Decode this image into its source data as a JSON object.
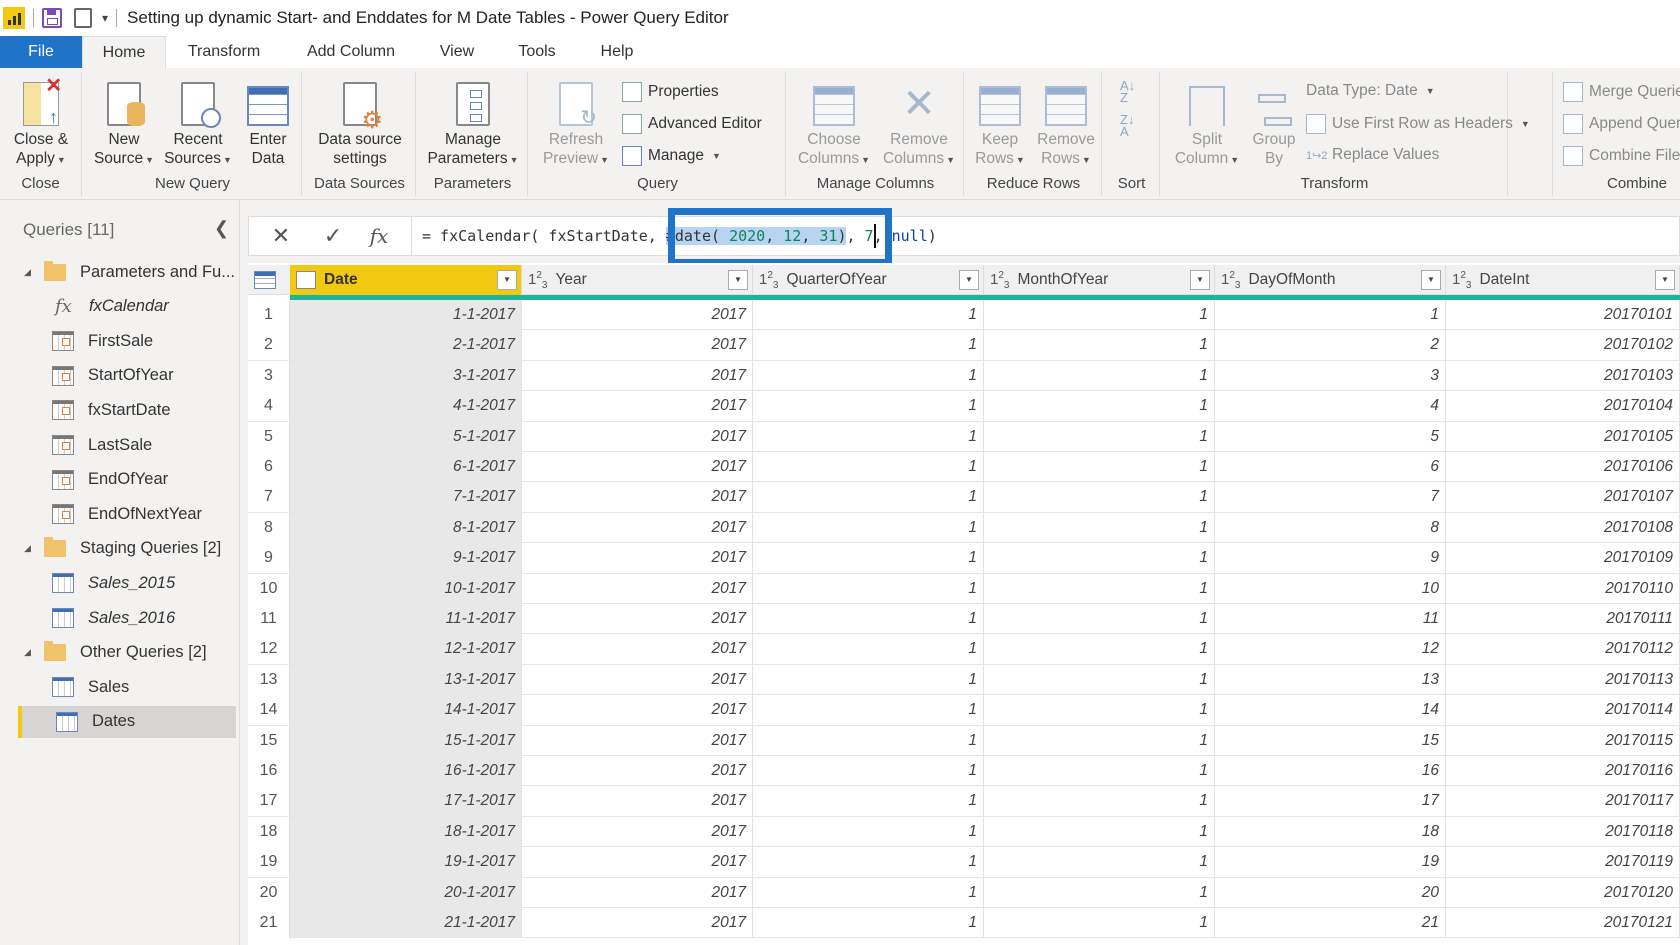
{
  "window": {
    "title": "Setting up dynamic Start- and Enddates for M Date Tables - Power Query Editor"
  },
  "menu": {
    "tabs": [
      "File",
      "Home",
      "Transform",
      "Add Column",
      "View",
      "Tools",
      "Help"
    ],
    "active": "Home"
  },
  "ribbon": {
    "groups": {
      "close": {
        "label": "Close",
        "close_apply": "Close &\nApply"
      },
      "new_query": {
        "label": "New Query",
        "new_source": "New\nSource",
        "recent_sources": "Recent\nSources",
        "enter_data": "Enter\nData"
      },
      "data_sources": {
        "label": "Data Sources",
        "settings": "Data source\nsettings"
      },
      "parameters": {
        "label": "Parameters",
        "manage": "Manage\nParameters"
      },
      "query": {
        "label": "Query",
        "refresh": "Refresh\nPreview",
        "properties": "Properties",
        "advanced_editor": "Advanced Editor",
        "manage": "Manage"
      },
      "manage_columns": {
        "label": "Manage Columns",
        "choose": "Choose\nColumns",
        "remove": "Remove\nColumns"
      },
      "reduce_rows": {
        "label": "Reduce Rows",
        "keep": "Keep\nRows",
        "remove": "Remove\nRows"
      },
      "sort": {
        "label": "Sort"
      },
      "transform": {
        "label": "Transform",
        "split": "Split\nColumn",
        "group": "Group\nBy",
        "data_type": "Data Type: Date",
        "first_row": "Use First Row as Headers",
        "replace": "Replace Values"
      },
      "combine": {
        "label": "Combine",
        "merge": "Merge Queries",
        "append": "Append Queries",
        "combine_files": "Combine Files"
      }
    }
  },
  "sidebar": {
    "title": "Queries [11]",
    "items": [
      {
        "type": "folder",
        "label": "Parameters and Fu..."
      },
      {
        "type": "function",
        "label": "fxCalendar"
      },
      {
        "type": "param",
        "label": "FirstSale"
      },
      {
        "type": "param",
        "label": "StartOfYear"
      },
      {
        "type": "param",
        "label": "fxStartDate"
      },
      {
        "type": "param",
        "label": "LastSale"
      },
      {
        "type": "param",
        "label": "EndOfYear"
      },
      {
        "type": "param",
        "label": "EndOfNextYear"
      },
      {
        "type": "folder",
        "label": "Staging Queries [2]"
      },
      {
        "type": "table-italic",
        "label": "Sales_2015"
      },
      {
        "type": "table-italic",
        "label": "Sales_2016"
      },
      {
        "type": "folder",
        "label": "Other Queries [2]"
      },
      {
        "type": "table",
        "label": "Sales"
      },
      {
        "type": "table",
        "label": "Dates",
        "selected": true
      }
    ]
  },
  "formula_bar": {
    "prefix": "= fxCalendar( fxStartDate, ",
    "selected": "#date( 2020, 12, 31)",
    "suffix": ", 7, null)"
  },
  "grid": {
    "columns": [
      {
        "name": "Date",
        "type": "date"
      },
      {
        "name": "Year",
        "type": "123"
      },
      {
        "name": "QuarterOfYear",
        "type": "123"
      },
      {
        "name": "MonthOfYear",
        "type": "123"
      },
      {
        "name": "DayOfMonth",
        "type": "123"
      },
      {
        "name": "DateInt",
        "type": "123"
      }
    ],
    "rows": [
      [
        "1-1-2017",
        "2017",
        "1",
        "1",
        "1",
        "20170101"
      ],
      [
        "2-1-2017",
        "2017",
        "1",
        "1",
        "2",
        "20170102"
      ],
      [
        "3-1-2017",
        "2017",
        "1",
        "1",
        "3",
        "20170103"
      ],
      [
        "4-1-2017",
        "2017",
        "1",
        "1",
        "4",
        "20170104"
      ],
      [
        "5-1-2017",
        "2017",
        "1",
        "1",
        "5",
        "20170105"
      ],
      [
        "6-1-2017",
        "2017",
        "1",
        "1",
        "6",
        "20170106"
      ],
      [
        "7-1-2017",
        "2017",
        "1",
        "1",
        "7",
        "20170107"
      ],
      [
        "8-1-2017",
        "2017",
        "1",
        "1",
        "8",
        "20170108"
      ],
      [
        "9-1-2017",
        "2017",
        "1",
        "1",
        "9",
        "20170109"
      ],
      [
        "10-1-2017",
        "2017",
        "1",
        "1",
        "10",
        "20170110"
      ],
      [
        "11-1-2017",
        "2017",
        "1",
        "1",
        "11",
        "20170111"
      ],
      [
        "12-1-2017",
        "2017",
        "1",
        "1",
        "12",
        "20170112"
      ],
      [
        "13-1-2017",
        "2017",
        "1",
        "1",
        "13",
        "20170113"
      ],
      [
        "14-1-2017",
        "2017",
        "1",
        "1",
        "14",
        "20170114"
      ],
      [
        "15-1-2017",
        "2017",
        "1",
        "1",
        "15",
        "20170115"
      ],
      [
        "16-1-2017",
        "2017",
        "1",
        "1",
        "16",
        "20170116"
      ],
      [
        "17-1-2017",
        "2017",
        "1",
        "1",
        "17",
        "20170117"
      ],
      [
        "18-1-2017",
        "2017",
        "1",
        "1",
        "18",
        "20170118"
      ],
      [
        "19-1-2017",
        "2017",
        "1",
        "1",
        "19",
        "20170119"
      ],
      [
        "20-1-2017",
        "2017",
        "1",
        "1",
        "20",
        "20170120"
      ],
      [
        "21-1-2017",
        "2017",
        "1",
        "1",
        "21",
        "20170121"
      ]
    ]
  },
  "colors": {
    "accent": "#1f73c8",
    "selected_column": "#f2c811",
    "quality_bar": "#1fb39a"
  }
}
